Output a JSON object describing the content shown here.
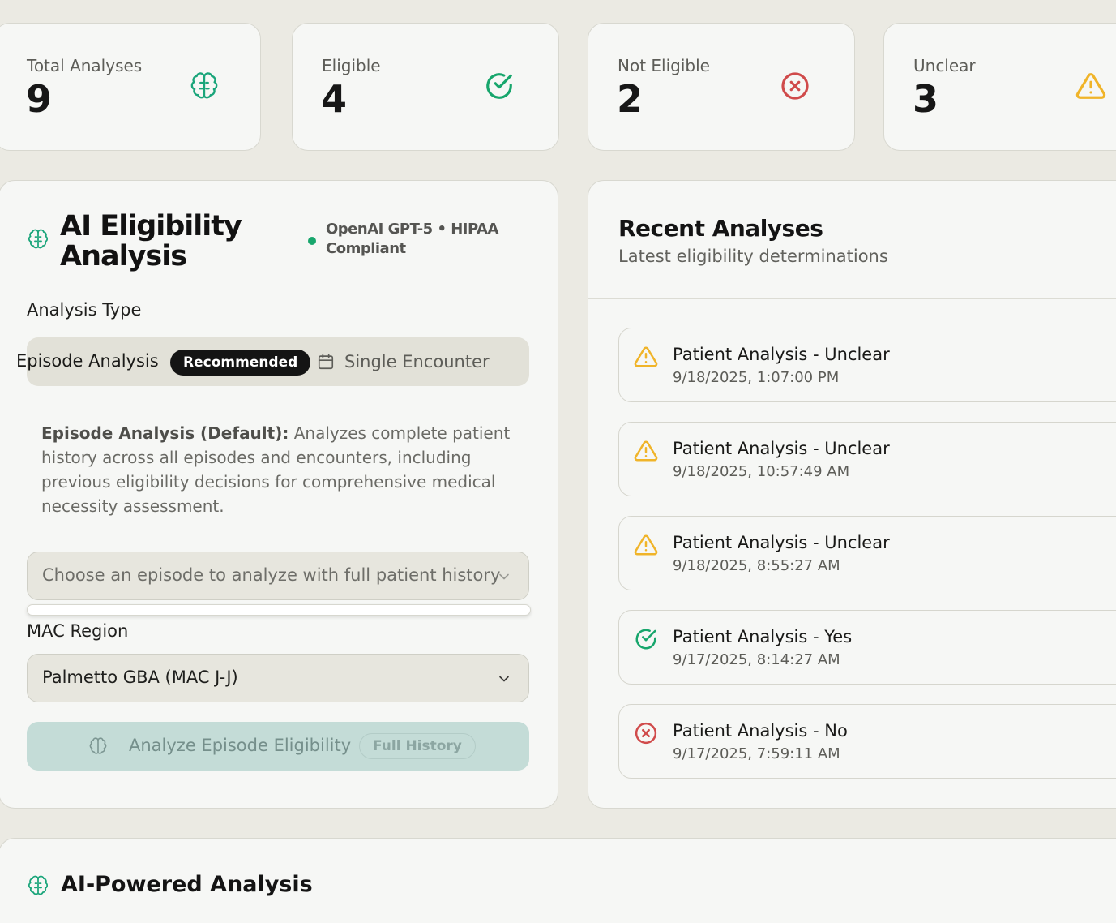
{
  "stats": [
    {
      "label": "Total Analyses",
      "value": "9",
      "icon": "brain-icon",
      "color": "#1aa57a"
    },
    {
      "label": "Eligible",
      "value": "4",
      "icon": "check-circle-icon",
      "color": "#17a66c"
    },
    {
      "label": "Not Eligible",
      "value": "2",
      "icon": "x-circle-icon",
      "color": "#d04b4b"
    },
    {
      "label": "Unclear",
      "value": "3",
      "icon": "warning-triangle-icon",
      "color": "#f0b429"
    }
  ],
  "analysis": {
    "title": "AI Eligibility Analysis",
    "model_status": "OpenAI GPT-5 • HIPAA Compliant",
    "analysis_type_label": "Analysis Type",
    "tab_episode": "Episode Analysis",
    "tab_episode_badge": "Recommended",
    "tab_single": "Single Encounter",
    "description_bold": "Episode Analysis (Default):",
    "description_rest": " Analyzes complete patient history across all episodes and encounters, including previous eligibility decisions for comprehensive medical necessity assessment.",
    "episode_placeholder": "Choose an episode to analyze with full patient history",
    "mac_region_label": "MAC Region",
    "mac_region_value": "Palmetto GBA (MAC J-J)",
    "analyze_button": "Analyze Episode Eligibility",
    "analyze_badge": "Full History"
  },
  "recent": {
    "title": "Recent Analyses",
    "subtitle": "Latest eligibility determinations",
    "items": [
      {
        "title": "Patient Analysis - Unclear",
        "time": "9/18/2025, 1:07:00 PM",
        "status": "unclear"
      },
      {
        "title": "Patient Analysis - Unclear",
        "time": "9/18/2025, 10:57:49 AM",
        "status": "unclear"
      },
      {
        "title": "Patient Analysis - Unclear",
        "time": "9/18/2025, 8:55:27 AM",
        "status": "unclear"
      },
      {
        "title": "Patient Analysis - Yes",
        "time": "9/17/2025, 8:14:27 AM",
        "status": "yes"
      },
      {
        "title": "Patient Analysis - No",
        "time": "9/17/2025, 7:59:11 AM",
        "status": "no"
      }
    ]
  },
  "powered": {
    "title": "AI-Powered Analysis"
  }
}
